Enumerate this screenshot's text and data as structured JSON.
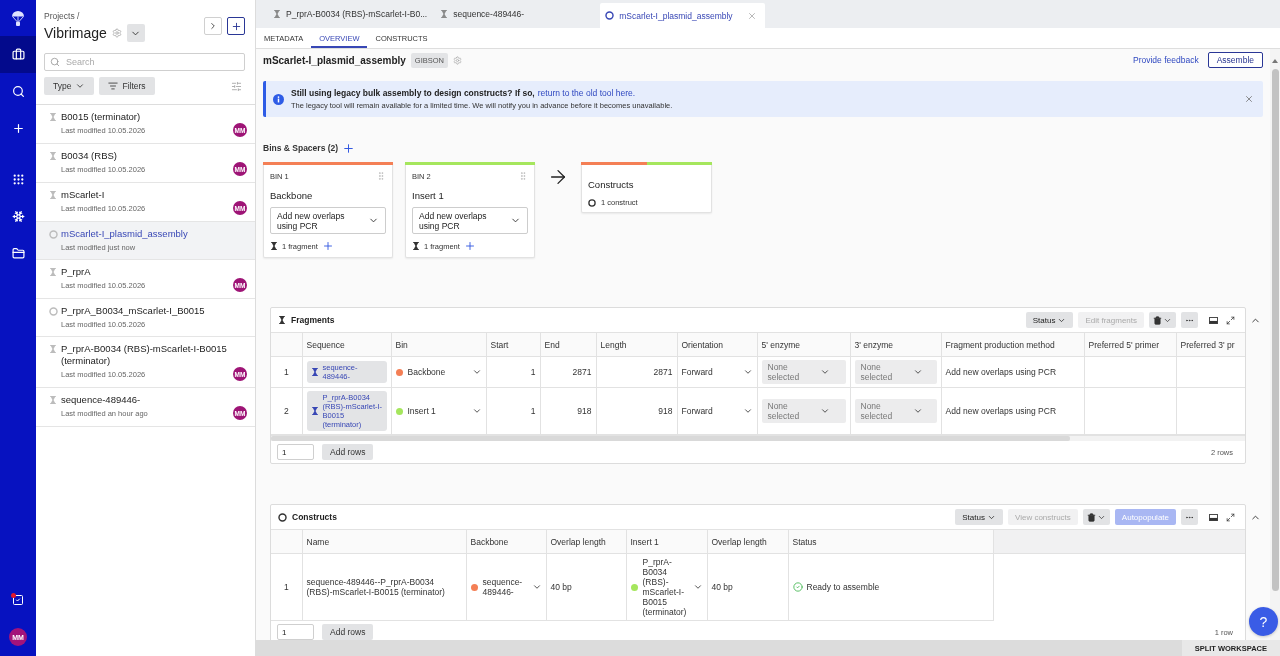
{
  "nav_rail": {
    "primary": [
      {
        "kind": "briefcase",
        "selected": true
      },
      {
        "kind": "search",
        "selected": false
      },
      {
        "kind": "plus",
        "selected": false
      }
    ],
    "secondary": [
      {
        "kind": "grid",
        "selected": false
      },
      {
        "kind": "molecule",
        "selected": false
      },
      {
        "kind": "folder",
        "selected": false
      }
    ],
    "tasks": {
      "notification": true
    },
    "avatar": "MM"
  },
  "sidebar": {
    "breadcrumb": "Projects /",
    "project": "Vibrimage",
    "search": {
      "placeholder": "Search"
    },
    "type_button": "Type",
    "filters_button": "Filters",
    "items": [
      {
        "kind": "sequence",
        "title": "B0015 (terminator)",
        "modified": "Last modified 10.05.2026",
        "avatar": "MM",
        "selected": false
      },
      {
        "kind": "sequence",
        "title": "B0034 (RBS)",
        "modified": "Last modified 10.05.2026",
        "avatar": "MM",
        "selected": false
      },
      {
        "kind": "sequence",
        "title": "mScarlet-I",
        "modified": "Last modified 10.05.2026",
        "avatar": "MM",
        "selected": false
      },
      {
        "kind": "construct",
        "title": "mScarlet-I_plasmid_assembly",
        "modified": "Last modified just now",
        "selected": true
      },
      {
        "kind": "sequence",
        "title": "P_rprA",
        "modified": "Last modified 10.05.2026",
        "avatar": "MM",
        "selected": false
      },
      {
        "kind": "construct",
        "title": "P_rprA_B0034_mScarlet-I_B0015",
        "modified": "Last modified 10.05.2026",
        "selected": false
      },
      {
        "kind": "sequence",
        "title": "P_rprA-B0034 (RBS)-mScarlet-I-B0015 (terminator)",
        "modified": "Last modified 10.05.2026",
        "avatar": "MM",
        "selected": false
      },
      {
        "kind": "sequence",
        "title": "sequence-489446-",
        "modified": "Last modified an hour ago",
        "avatar": "MM",
        "selected": false
      }
    ]
  },
  "tabs": [
    {
      "kind": "sequence",
      "label": "P_rprA-B0034 (RBS)-mScarlet-I-B0...",
      "selected": false
    },
    {
      "kind": "sequence",
      "label": "sequence-489446-",
      "selected": false
    },
    {
      "kind": "construct",
      "label": "mScarlet-I_plasmid_assembly",
      "selected": true
    }
  ],
  "subtabs": [
    {
      "label": "METADATA",
      "selected": false
    },
    {
      "label": "OVERVIEW",
      "selected": true
    },
    {
      "label": "CONSTRUCTS",
      "selected": false
    }
  ],
  "header": {
    "title": "mScarlet-I_plasmid_assembly",
    "method": "GIBSON",
    "feedback_link": "Provide feedback",
    "assemble_button": "Assemble"
  },
  "banner": {
    "heading": "Still using legacy bulk assembly to design constructs? If so,",
    "link": "return to the old tool here.",
    "note": "The legacy tool will remain available for a limited time. We will notify you in advance before it becomes unavailable."
  },
  "bins_section": {
    "title": "Bins & Spacers (2)",
    "bins": [
      {
        "label": "BIN 1",
        "name": "Backbone",
        "color": "#f47f55",
        "method": "Add new overlaps using PCR",
        "fragments": "1 fragment"
      },
      {
        "label": "BIN 2",
        "name": "Insert 1",
        "color": "#a5e65d",
        "method": "Add new overlaps using PCR",
        "fragments": "1 fragment"
      }
    ],
    "result": {
      "title": "Constructs",
      "count": "1 construct"
    }
  },
  "fragments": {
    "title": "Fragments",
    "status_button": "Status",
    "actions": [
      {
        "kind": "secondary",
        "label": "Edit fragments",
        "disabled": true
      }
    ],
    "columns": [
      "Sequence",
      "Bin",
      "Start",
      "End",
      "Length",
      "Orientation",
      "5' enzyme",
      "3' enzyme",
      "Fragment production method",
      "Preferred 5' primer",
      "Preferred 3' pr"
    ],
    "rows": [
      {
        "number": "1",
        "sequence": "sequence-489446-",
        "bin": "Backbone",
        "color": "#f47f55",
        "start": "1",
        "end": "2871",
        "length": "2871",
        "orientation": "Forward",
        "enzyme_5": "None selected",
        "enzyme_3": "None selected",
        "method": "Add new overlaps using PCR"
      },
      {
        "number": "2",
        "sequence": "P_rprA-B0034 (RBS)-mScarlet-I-B0015 (terminator)",
        "bin": "Insert 1",
        "color": "#a5e65d",
        "start": "1",
        "end": "918",
        "length": "918",
        "orientation": "Forward",
        "enzyme_5": "None selected",
        "enzyme_3": "None selected",
        "method": "Add new overlaps using PCR"
      }
    ],
    "row_input": "1",
    "add_rows_button": "Add rows",
    "row_count": "2 rows"
  },
  "constructs": {
    "title": "Constructs",
    "status_button": "Status",
    "actions": [
      {
        "kind": "secondary",
        "label": "View constructs",
        "disabled": true
      },
      {
        "kind": "primary",
        "label": "Autopopulate",
        "disabled": true
      }
    ],
    "columns": [
      "Name",
      "Backbone",
      "Overlap length",
      "Insert 1",
      "Overlap length",
      "Status"
    ],
    "rows": [
      {
        "number": "1",
        "name": "sequence-489446--P_rprA-B0034 (RBS)-mScarlet-I-B0015 (terminator)",
        "backbone": {
          "label": "sequence-489446-",
          "color": "#f47f55"
        },
        "overlap_1": "40 bp",
        "insert": {
          "label": "P_rprA-B0034 (RBS)-mScarlet-I-B0015 (terminator)",
          "color": "#a5e65d"
        },
        "overlap_2": "40 bp",
        "status": "Ready to assemble"
      }
    ],
    "row_input": "1",
    "add_rows_button": "Add rows",
    "row_count": "1 row"
  },
  "help_button": "?",
  "bottom_bar": {
    "split_button": "SPLIT WORKSPACE"
  }
}
